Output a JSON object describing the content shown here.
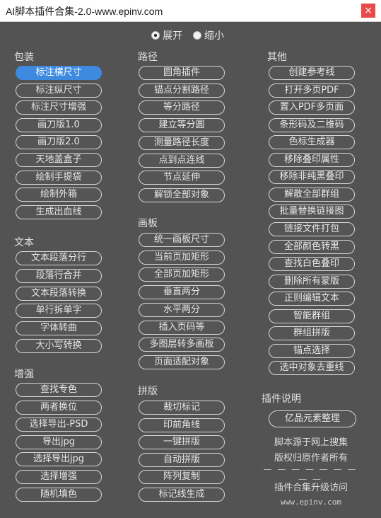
{
  "window": {
    "title": "AI脚本插件合集-2.0-www.epinv.com",
    "close": "×"
  },
  "mode": {
    "expand": "展开",
    "collapse": "缩小",
    "selected": "expand"
  },
  "sections": {
    "packaging": {
      "label": "包装",
      "items": [
        "标注横尺寸",
        "标注纵尺寸",
        "标注尺寸增强",
        "画刀版1.0",
        "画刀版2.0",
        "天地盖盒子",
        "绘制手提袋",
        "绘制外箱",
        "生成出血线"
      ]
    },
    "text": {
      "label": "文本",
      "items": [
        "文本段落分行",
        "段落行合并",
        "文本段落转换",
        "单行拆单字",
        "字体转曲",
        "大小写转换"
      ]
    },
    "enhance": {
      "label": "增强",
      "items": [
        "查找专色",
        "两者换位",
        "选择导出-PSD",
        "导出jpg",
        "选择导出jpg",
        "选择增强",
        "随机填色"
      ]
    },
    "path": {
      "label": "路径",
      "items": [
        "圆角插件",
        "锚点分割路径",
        "等分路径",
        "建立等分圆",
        "测量路径长度",
        "点到点连线",
        "节点延伸",
        "解锁全部对象"
      ]
    },
    "artboard": {
      "label": "画板",
      "items": [
        "统一画板尺寸",
        "当前页加矩形",
        "全部页加矩形",
        "垂直两分",
        "水平两分",
        "插入页码等",
        "多图层转多画板",
        "页面适配对象"
      ]
    },
    "imposition": {
      "label": "拼版",
      "items": [
        "裁切标记",
        "印前角线",
        "一键拼版",
        "自动拼版",
        "阵列复制",
        "标记线生成"
      ]
    },
    "other": {
      "label": "其他",
      "items": [
        "创建参考线",
        "打开多页PDF",
        "置入PDF多页面",
        "条形码及二维码",
        "色标生成器",
        "移除叠印属性",
        "移除非纯黑叠印",
        "解散全部群组",
        "批量替换链接图",
        "链接文件打包",
        "全部颜色转黑",
        "查找白色叠印",
        "删除所有蒙版",
        "正则编辑文本",
        "智能群组",
        "群组拼版",
        "锚点选择",
        "选中对象去重线"
      ]
    },
    "about": {
      "label": "插件说明",
      "button": "亿品元素整理",
      "line1": "脚本源于网上搜集",
      "line2": "版权归原作者所有",
      "divider": "— — — — — — — — —",
      "upgrade": "插件合集升级访问",
      "url": "www.epinv.com"
    }
  },
  "colors": {
    "background": "#535353",
    "active": "#3d8ae0"
  }
}
